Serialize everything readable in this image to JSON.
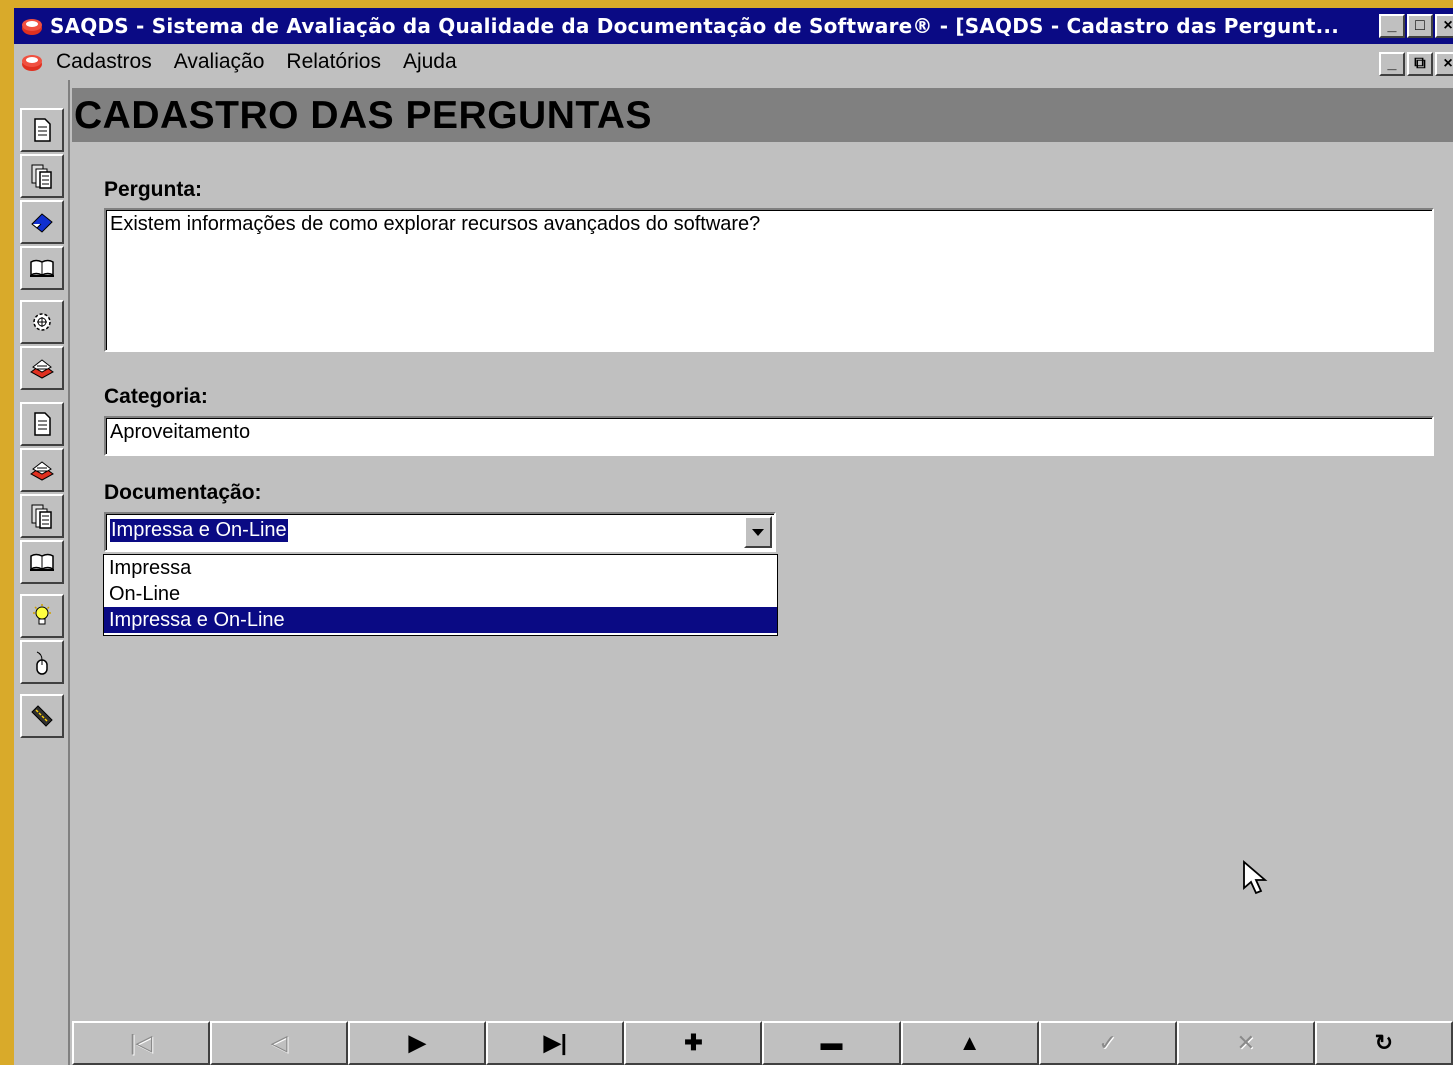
{
  "window": {
    "title": "SAQDS - Sistema de Avaliação da Qualidade da Documentação de Software® - [SAQDS - Cadastro das Pergunt...",
    "controls": {
      "minimize": "_",
      "maximize": "□",
      "close": "×"
    }
  },
  "menu": {
    "items": [
      "Cadastros",
      "Avaliação",
      "Relatórios",
      "Ajuda"
    ],
    "mdi_controls": {
      "minimize": "_",
      "restore": "⧉",
      "close": "×"
    }
  },
  "toolbar": {
    "icons": [
      "document-icon",
      "documents-icon",
      "eraser-icon",
      "book-icon",
      "gear-icon",
      "chemistry-icon",
      "document-icon",
      "chemistry-icon",
      "documents-icon",
      "book-icon",
      "lightbulb-icon",
      "mouse-icon",
      "ruler-icon"
    ]
  },
  "page": {
    "title": "CADASTRO DAS PERGUNTAS",
    "pergunta_label": "Pergunta:",
    "pergunta_value": "Existem informações de como explorar recursos avançados do software?",
    "categoria_label": "Categoria:",
    "categoria_value": "Aproveitamento",
    "documentacao_label": "Documentação:",
    "documentacao_value": "Impressa e On-Line",
    "documentacao_options": [
      "Impressa",
      "On-Line",
      "Impressa e On-Line"
    ],
    "documentacao_selected_index": 2
  },
  "navigator": {
    "buttons": [
      {
        "name": "first-record-button",
        "glyph": "|◁",
        "enabled": false
      },
      {
        "name": "prior-record-button",
        "glyph": "◁",
        "enabled": false
      },
      {
        "name": "next-record-button",
        "glyph": "▶",
        "enabled": true
      },
      {
        "name": "last-record-button",
        "glyph": "▶|",
        "enabled": true
      },
      {
        "name": "insert-record-button",
        "glyph": "✚",
        "enabled": true
      },
      {
        "name": "delete-record-button",
        "glyph": "▬",
        "enabled": true
      },
      {
        "name": "edit-record-button",
        "glyph": "▲",
        "enabled": true
      },
      {
        "name": "post-record-button",
        "glyph": "✓",
        "enabled": false
      },
      {
        "name": "cancel-record-button",
        "glyph": "✕",
        "enabled": false
      },
      {
        "name": "refresh-button",
        "glyph": "↻",
        "enabled": true
      }
    ]
  },
  "colors": {
    "titlebar": "#0a0a84",
    "face": "#c0c0c0",
    "header_band": "#808080",
    "desktop": "#d9aa2a",
    "selection": "#0a0a84"
  }
}
